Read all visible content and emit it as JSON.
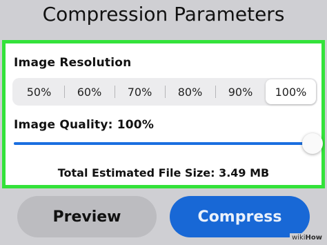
{
  "header": {
    "title": "Compression Parameters"
  },
  "resolution": {
    "label": "Image Resolution",
    "options": [
      "50%",
      "60%",
      "70%",
      "80%",
      "90%",
      "100%"
    ],
    "selected": "100%"
  },
  "quality": {
    "label": "Image Quality: 100%",
    "level_percent": 100
  },
  "estimate": {
    "text": "Total Estimated File Size: 3.49 MB"
  },
  "actions": {
    "preview_label": "Preview",
    "compress_label": "Compress"
  },
  "colors": {
    "highlight_border": "#33e23a",
    "accent": "#1868d6",
    "background": "#cfcfd3"
  },
  "watermark": {
    "prefix": "wiki",
    "suffix": "How"
  }
}
